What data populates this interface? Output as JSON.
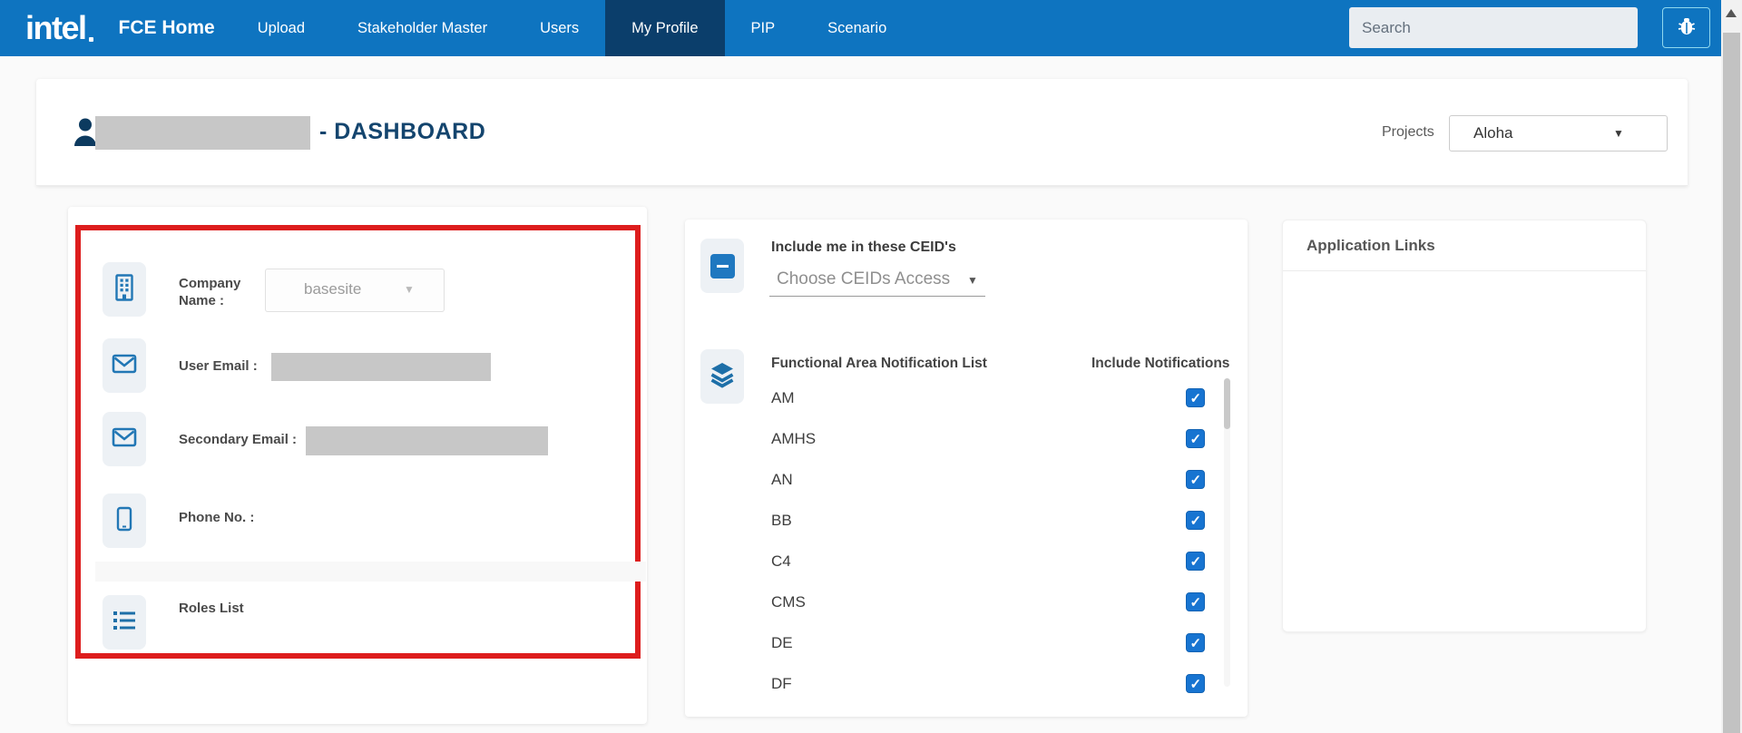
{
  "navbar": {
    "brand": "intel",
    "app_title": "FCE Home",
    "items": [
      {
        "label": "Upload",
        "active": false
      },
      {
        "label": "Stakeholder Master",
        "active": false
      },
      {
        "label": "Users",
        "active": false
      },
      {
        "label": "My Profile",
        "active": true
      },
      {
        "label": "PIP",
        "active": false
      },
      {
        "label": "Scenario",
        "active": false
      }
    ],
    "search": {
      "placeholder": "Search",
      "value": ""
    }
  },
  "header": {
    "user_name_redacted": "",
    "title": "- DASHBOARD",
    "projects_label": "Projects",
    "projects_selected": "Aloha"
  },
  "profile_panel": {
    "company": {
      "label": "Company Name :",
      "selected": "basesite"
    },
    "user_email": {
      "label": "User Email :",
      "value_redacted": ""
    },
    "secondary_email": {
      "label": "Secondary Email :",
      "value_redacted": ""
    },
    "phone": {
      "label": "Phone No. :",
      "value": ""
    },
    "roles": {
      "label": "Roles List"
    }
  },
  "ceid_section": {
    "title": "Include me in these CEID's",
    "select_placeholder": "Choose CEIDs Access"
  },
  "notification_section": {
    "list_title": "Functional Area Notification List",
    "checkbox_column_title": "Include Notifications",
    "items": [
      {
        "label": "AM",
        "checked": true
      },
      {
        "label": "AMHS",
        "checked": true
      },
      {
        "label": "AN",
        "checked": true
      },
      {
        "label": "BB",
        "checked": true
      },
      {
        "label": "C4",
        "checked": true
      },
      {
        "label": "CMS",
        "checked": true
      },
      {
        "label": "DE",
        "checked": true
      },
      {
        "label": "DF",
        "checked": true
      }
    ]
  },
  "application_links": {
    "title": "Application Links"
  },
  "colors": {
    "nav_blue": "#0e74c0",
    "nav_active_blue": "#0b3e6b",
    "title_navy": "#14456e",
    "icon_blue": "#2277b5",
    "checkbox_blue": "#1774d1",
    "highlight_red": "#dd1d1d",
    "redaction_gray": "#c7c7c7"
  }
}
